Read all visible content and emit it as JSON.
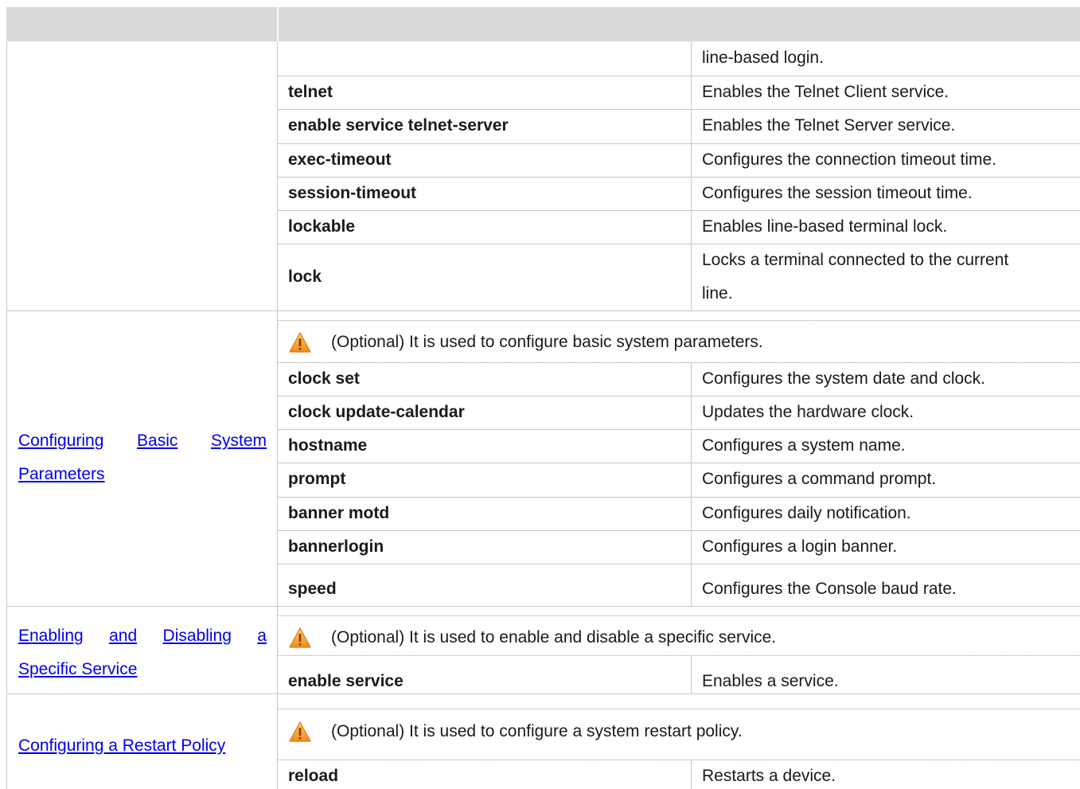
{
  "table": {
    "continued_rows": [
      {
        "command": "",
        "description": "line-based login."
      },
      {
        "command": "telnet",
        "description": "Enables the Telnet Client service."
      },
      {
        "command": "enable service telnet-server",
        "description": "Enables the Telnet Server service."
      },
      {
        "command": "exec-timeout",
        "description": "Configures the connection timeout time."
      },
      {
        "command": "session-timeout",
        "description": "Configures the session timeout time."
      },
      {
        "command": "lockable",
        "description": "Enables line-based terminal lock."
      },
      {
        "command": "lock",
        "description_line1": "Locks a terminal connected to the current",
        "description_line2": "line."
      }
    ],
    "groups": [
      {
        "task_line1": [
          "Configuring",
          "Basic",
          "System"
        ],
        "task_line2": "Parameters",
        "note": "(Optional) It is used to configure basic system parameters.",
        "rows": [
          {
            "command": "clock set",
            "description": "Configures the system date and clock."
          },
          {
            "command": "clock update-calendar",
            "description": "Updates the hardware clock."
          },
          {
            "command": "hostname",
            "description": "Configures a system name."
          },
          {
            "command": "prompt",
            "description": "Configures a command prompt."
          },
          {
            "command": "banner motd",
            "description": "Configures daily notification."
          },
          {
            "command": "bannerlogin",
            "description": "Configures a login banner."
          },
          {
            "command": "speed",
            "description": "Configures the Console baud rate."
          }
        ]
      },
      {
        "task_line1": [
          "Enabling",
          "and",
          "Disabling",
          "a"
        ],
        "task_line2": "Specific Service",
        "note": "(Optional) It is used to enable and disable a specific service.",
        "rows": [
          {
            "command": "enable service",
            "description": "Enables a service."
          }
        ]
      },
      {
        "task": "Configuring a Restart Policy",
        "note": "(Optional) It is used to configure a system restart policy.",
        "rows": [
          {
            "command": "reload",
            "description": "Restarts a device."
          }
        ]
      }
    ]
  },
  "icons": {
    "warning": "warning-triangle-icon"
  },
  "colors": {
    "header_bg": "#d9d9d9",
    "link": "#0000ee",
    "warning_orange": "#f39c12"
  }
}
